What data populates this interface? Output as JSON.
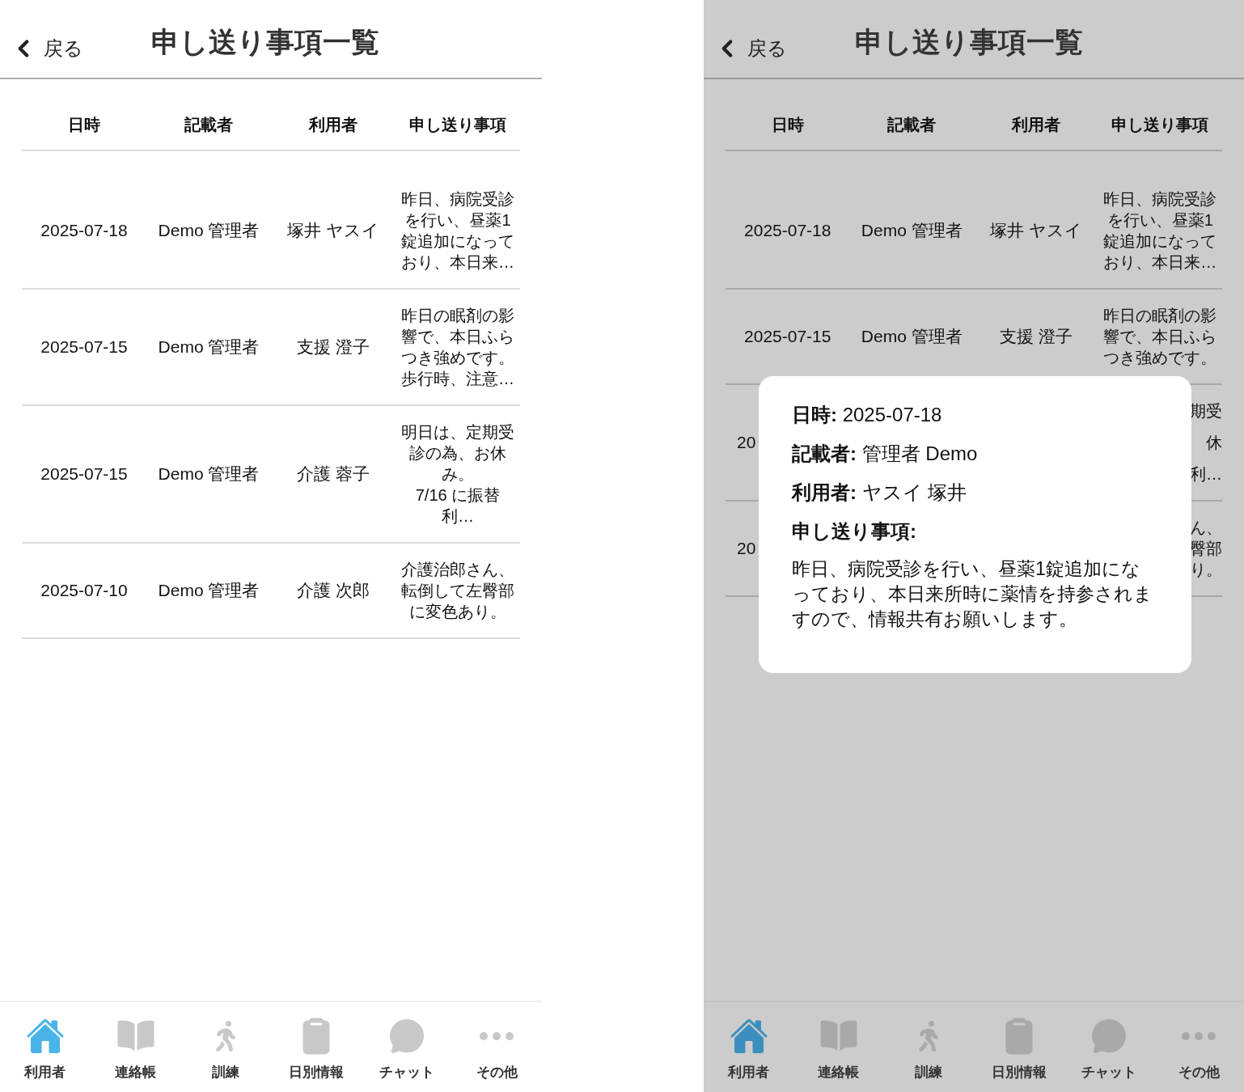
{
  "screens": [
    {
      "dimmed": false,
      "back": "戻る",
      "title": "申し送り事項一覧",
      "columns": [
        "日時",
        "記載者",
        "利用者",
        "申し送り事項"
      ],
      "rows": [
        {
          "date": "2025-07-18",
          "author": "Demo 管理者",
          "user": "塚井 ヤスイ",
          "memo": "昨日、病院受診を行い、昼薬1錠追加になっており、本日来…"
        },
        {
          "date": "2025-07-15",
          "author": "Demo 管理者",
          "user": "支援 澄子",
          "memo": "昨日の眠剤の影響で、本日ふらつき強めです。歩行時、注意…"
        },
        {
          "date": "2025-07-15",
          "author": "Demo 管理者",
          "user": "介護 蓉子",
          "memo": "明日は、定期受診の為、お休み。\n7/16 に振替利…"
        },
        {
          "date": "2025-07-10",
          "author": "Demo 管理者",
          "user": "介護 次郎",
          "memo": "介護治郎さん、転倒して左臀部に変色あり。"
        }
      ],
      "tabs": [
        {
          "label": "利用者",
          "selected": true
        },
        {
          "label": "連絡帳",
          "selected": false
        },
        {
          "label": "訓練",
          "selected": false
        },
        {
          "label": "日別情報",
          "selected": false
        },
        {
          "label": "チャット",
          "selected": false
        },
        {
          "label": "その他",
          "selected": false
        }
      ]
    },
    {
      "dimmed": true,
      "back": "戻る",
      "title": "申し送り事項一覧",
      "columns": [
        "日時",
        "記載者",
        "利用者",
        "申し送り事項"
      ],
      "rows": [
        {
          "date": "2025-07-18",
          "author": "Demo 管理者",
          "user": "塚井 ヤスイ",
          "memo": "昨日、病院受診を行い、昼薬1錠追加になっており、本日来…"
        },
        {
          "date": "2025-07-15",
          "author": "Demo 管理者",
          "user": "支援 澄子",
          "memo": "昨日の眠剤の影響で、本日ふらつき強めです。"
        },
        {
          "date": "20",
          "memo_parts": [
            "期受",
            "休",
            "利…"
          ]
        },
        {
          "date": "20",
          "memo_parts": [
            "ん、",
            "臀部",
            "り。"
          ]
        }
      ],
      "dialog": {
        "fields": [
          {
            "label": "日時:",
            "value": "2025-07-18"
          },
          {
            "label": "記載者:",
            "value": "管理者 Demo"
          },
          {
            "label": "利用者:",
            "value": "ヤスイ 塚井"
          }
        ],
        "memo_label": "申し送り事項:",
        "memo": "昨日、病院受診を行い、昼薬1錠追加になっており、本日来所時に薬情を持参されますので、情報共有お願いします。"
      },
      "tabs": [
        {
          "label": "利用者",
          "selected": true
        },
        {
          "label": "連絡帳",
          "selected": false
        },
        {
          "label": "訓練",
          "selected": false
        },
        {
          "label": "日別情報",
          "selected": false
        },
        {
          "label": "チャット",
          "selected": false
        },
        {
          "label": "その他",
          "selected": false
        }
      ]
    }
  ]
}
